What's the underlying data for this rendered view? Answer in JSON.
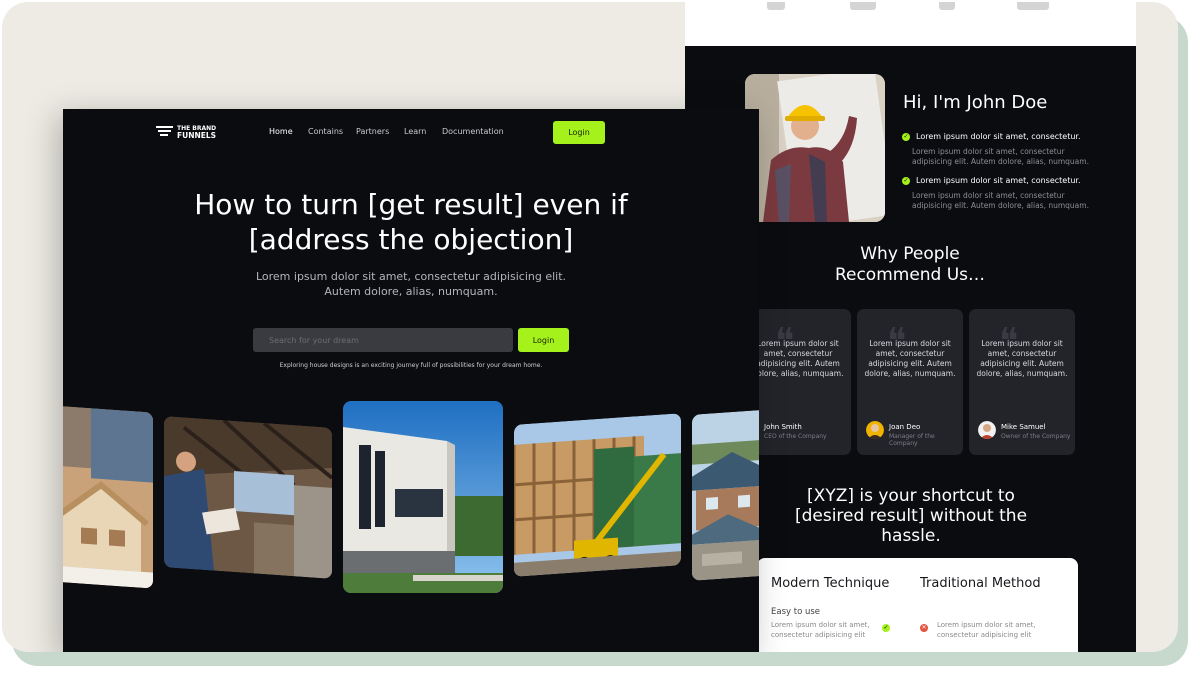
{
  "left_page": {
    "brand": {
      "line1": "THE BRAND",
      "line2": "FUNNELS"
    },
    "nav": {
      "items": [
        {
          "label": "Home",
          "active": true
        },
        {
          "label": "Contains",
          "active": false
        },
        {
          "label": "Partners",
          "active": false
        },
        {
          "label": "Learn",
          "active": false
        },
        {
          "label": "Documentation",
          "active": false
        }
      ],
      "login_label": "Login"
    },
    "hero": {
      "title_line1": "How to turn [get result] even if",
      "title_line2": "[address the objection]",
      "subtitle": "Lorem ipsum dolor sit amet, consectetur adipisicing elit. Autem dolore, alias, numquam."
    },
    "search": {
      "placeholder": "Search for your dream",
      "button_label": "Login",
      "note": "Exploring house designs is an exciting journey full of possibilities for your dream home."
    },
    "gallery": [
      "house-model-photo",
      "construction-workers-photo",
      "modern-house-photo",
      "house-frame-construction-photo",
      "residential-houses-photo"
    ]
  },
  "right_page": {
    "about": {
      "title": "Hi, I'm John Doe",
      "bullets": [
        {
          "heading": "Lorem ipsum dolor sit amet, consectetur.",
          "text": "Lorem ipsum dolor sit amet, consectetur adipisicing elit. Autem dolore, alias, numquam."
        },
        {
          "heading": "Lorem ipsum dolor sit amet, consectetur.",
          "text": "Lorem ipsum dolor sit amet, consectetur adipisicing elit. Autem dolore, alias, numquam."
        }
      ]
    },
    "why": {
      "line1": "Why People",
      "line2": "Recommend Us…"
    },
    "reviews": [
      {
        "text": "Lorem ipsum dolor sit amet, consectetur adipisicing elit. Autem dolore, alias, numquam.",
        "name": "John Smith",
        "role": "CEO of the Company"
      },
      {
        "text": "Lorem ipsum dolor sit amet, consectetur adipisicing elit. Autem dolore, alias, numquam.",
        "name": "Joan Deo",
        "role": "Manager of the Company"
      },
      {
        "text": "Lorem ipsum dolor sit amet, consectetur adipisicing elit. Autem dolore, alias, numquam.",
        "name": "Mike Samuel",
        "role": "Owner of the Company"
      }
    ],
    "xyz": {
      "line1": "[XYZ] is your shortcut to",
      "line2": "[desired result] without the",
      "line3": "hassle."
    },
    "compare": {
      "modern_heading": "Modern Technique",
      "traditional_heading": "Traditional Method",
      "row_label": "Easy to use",
      "modern_text": "Lorem ipsum dolor sit amet, consectetur adipisicing elit",
      "traditional_text": "Lorem ipsum dolor sit amet, consectetur adipisicing elit"
    }
  },
  "colors": {
    "accent": "#a4f11c",
    "page_bg": "#0b0c10",
    "card_bg": "#23242a",
    "frame_bg": "#eeebe4",
    "negative": "#e5533d"
  }
}
